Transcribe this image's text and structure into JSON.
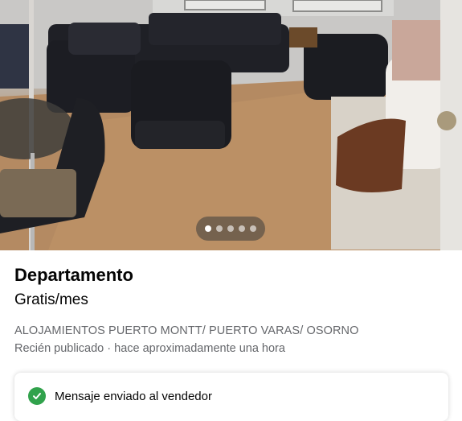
{
  "listing": {
    "title": "Departamento",
    "price": "Gratis/mes",
    "group": "ALOJAMIENTOS PUERTO MONTT/ PUERTO VARAS/ OSORNO",
    "posted": "Recién publicado · hace aproximadamente una hora"
  },
  "carousel": {
    "total": 5,
    "current": 1
  },
  "toast": {
    "message": "Mensaje enviado al vendedor",
    "icon": "check-circle-icon",
    "color": "#31a24c"
  },
  "colors": {
    "primary_text": "#050505",
    "secondary_text": "#65676b",
    "success": "#31a24c"
  }
}
